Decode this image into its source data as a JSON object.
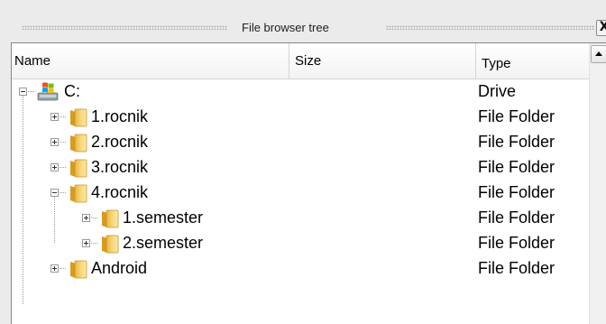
{
  "titlebar": {
    "title": "File browser tree",
    "close_label": "X"
  },
  "columns": {
    "name": "Name",
    "size": "Size",
    "type": "Type"
  },
  "rows": [
    {
      "name": "C:",
      "type": "Drive",
      "depth": 0,
      "expanded": true,
      "icon": "drive-icon"
    },
    {
      "name": "1.rocnik",
      "type": "File Folder",
      "depth": 1,
      "expanded": false,
      "icon": "folder-icon"
    },
    {
      "name": "2.rocnik",
      "type": "File Folder",
      "depth": 1,
      "expanded": false,
      "icon": "folder-icon"
    },
    {
      "name": "3.rocnik",
      "type": "File Folder",
      "depth": 1,
      "expanded": false,
      "icon": "folder-icon"
    },
    {
      "name": "4.rocnik",
      "type": "File Folder",
      "depth": 1,
      "expanded": true,
      "icon": "folder-icon"
    },
    {
      "name": "1.semester",
      "type": "File Folder",
      "depth": 2,
      "expanded": false,
      "icon": "folder-icon"
    },
    {
      "name": "2.semester",
      "type": "File Folder",
      "depth": 2,
      "expanded": false,
      "icon": "folder-icon"
    },
    {
      "name": "Android",
      "type": "File Folder",
      "depth": 1,
      "expanded": false,
      "icon": "folder-icon"
    }
  ]
}
